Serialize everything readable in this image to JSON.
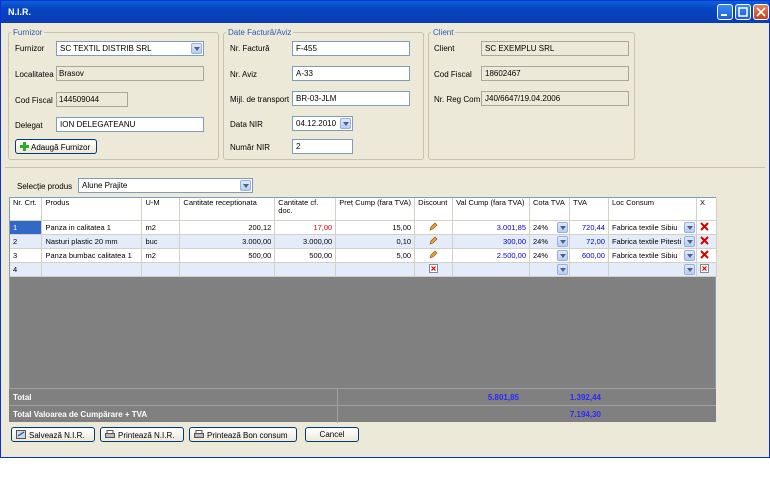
{
  "window": {
    "title": "N.I.R."
  },
  "furnizor": {
    "legend": "Furnizor",
    "furnizor_label": "Furnizor",
    "furnizor_value": "SC TEXTIL DISTRIB SRL",
    "localitatea_label": "Localitatea",
    "localitatea_value": "Brasov",
    "cod_fiscal_label": "Cod Fiscal",
    "cod_fiscal_value": "144509044",
    "delegat_label": "Delegat",
    "delegat_value": "ION DELEGATEANU",
    "add_button": "Adaugă Furnizor"
  },
  "factura": {
    "legend": "Date Factură/Aviz",
    "nr_factura_label": "Nr. Factură",
    "nr_factura_value": "F-455",
    "nr_aviz_label": "Nr. Aviz",
    "nr_aviz_value": "A-33",
    "transport_label": "Mijl. de transport",
    "transport_value": "BR-03-JLM",
    "data_label": "Data NIR",
    "data_value": "04.12.2010",
    "numar_label": "Număr NIR",
    "numar_value": "2"
  },
  "client": {
    "legend": "Client",
    "client_label": "Client",
    "client_value": "SC EXEMPLU SRL",
    "cod_fiscal_label": "Cod Fiscal",
    "cod_fiscal_value": "18602467",
    "nr_reg_label": "Nr. Reg Com",
    "nr_reg_value": "J40/6647/19.04.2006"
  },
  "selectie": {
    "label": "Selecție produs",
    "value": "Alune Prajite"
  },
  "table": {
    "headers": [
      "Nr. Crt.",
      "Produs",
      "U-M",
      "Cantitate receptionata",
      "Cantitate cf. doc.",
      "Preț Cump (fara TVA)",
      "Discount",
      "Val Cump (fara TVA)",
      "Cota TVA",
      "TVA",
      "Loc Consum",
      "X"
    ],
    "rows": [
      {
        "nr": "1",
        "produs": "Panza in calitatea 1",
        "um": "m2",
        "cant_rec": "200,12",
        "cant_doc": "17,00",
        "pret": "15,00",
        "val": "3.001,85",
        "cota": "24%",
        "tva": "720,44",
        "loc": "Fabrica textile Sibiu"
      },
      {
        "nr": "2",
        "produs": "Nasturi plastic 20 mm",
        "um": "buc",
        "cant_rec": "3.000,00",
        "cant_doc": "3.000,00",
        "pret": "0,10",
        "val": "300,00",
        "cota": "24%",
        "tva": "72,00",
        "loc": "Fabrica textile Pitesti"
      },
      {
        "nr": "3",
        "produs": "Panza bumbac calitatea 1",
        "um": "m2",
        "cant_rec": "500,00",
        "cant_doc": "500,00",
        "pret": "5,00",
        "val": "2.500,00",
        "cota": "24%",
        "tva": "600,00",
        "loc": "Fabrica textile Sibiu"
      },
      {
        "nr": "4",
        "produs": "",
        "um": "",
        "cant_rec": "",
        "cant_doc": "",
        "pret": "",
        "val": "",
        "cota": "",
        "tva": "",
        "loc": ""
      }
    ]
  },
  "totals": {
    "total_label": "Total",
    "total_val": "5.801,85",
    "total_tva": "1.392,44",
    "grand_label": "Total Valoarea de Cumpărare + TVA",
    "grand_value": "7.194,30"
  },
  "buttons": {
    "save": "Salvează N.I.R.",
    "print_nir": "Printează N.I.R.",
    "print_bon": "Printează Bon consum",
    "cancel": "Cancel"
  },
  "colors": {
    "title_bar": "#0a4fd0",
    "accent": "#2b59b8",
    "red_value": "#e00000",
    "blue_value": "#0000c8"
  }
}
